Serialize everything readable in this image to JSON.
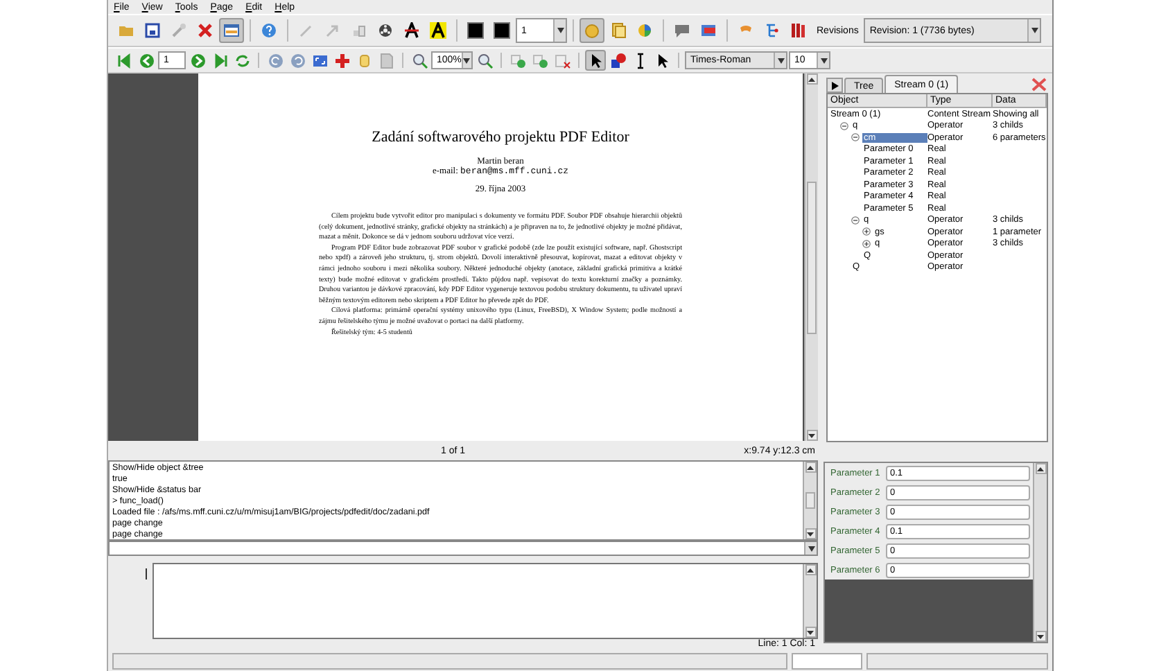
{
  "menu": [
    "File",
    "View",
    "Tools",
    "Page",
    "Edit",
    "Help"
  ],
  "toolbar_top": [
    {
      "kind": "button",
      "pressed": false
    },
    {
      "kind": "button",
      "pressed": false
    },
    {
      "kind": "button",
      "pressed": false
    },
    {
      "kind": "button",
      "pressed": false
    },
    {
      "kind": "button",
      "pressed": true
    },
    {
      "kind": "separator"
    },
    {
      "kind": "button",
      "pressed": false
    },
    {
      "kind": "separator"
    },
    {
      "kind": "button",
      "pressed": false
    },
    {
      "kind": "button",
      "pressed": false
    },
    {
      "kind": "button",
      "pressed": false
    },
    {
      "kind": "button",
      "pressed": false
    },
    {
      "kind": "button",
      "pressed": false
    },
    {
      "kind": "button",
      "pressed": false
    },
    {
      "kind": "separator"
    },
    {
      "kind": "button",
      "pressed": false
    },
    {
      "kind": "button",
      "pressed": false
    },
    {
      "kind": "spin",
      "value": "1"
    },
    {
      "kind": "separator"
    },
    {
      "kind": "button",
      "pressed": true
    },
    {
      "kind": "button",
      "pressed": false
    },
    {
      "kind": "button",
      "pressed": false
    },
    {
      "kind": "separator"
    },
    {
      "kind": "button",
      "pressed": false
    },
    {
      "kind": "button",
      "pressed": false
    },
    {
      "kind": "separator"
    },
    {
      "kind": "button",
      "pressed": false
    },
    {
      "kind": "button",
      "pressed": false
    },
    {
      "kind": "button",
      "pressed": false
    },
    {
      "kind": "label",
      "text": "Revisions"
    },
    {
      "kind": "combo",
      "value": "Revision: 1 (7736 bytes)"
    }
  ],
  "toolbar_bottom": [
    {
      "kind": "button",
      "pressed": false
    },
    {
      "kind": "button",
      "pressed": false
    },
    {
      "kind": "spin",
      "value": "1"
    },
    {
      "kind": "button",
      "pressed": false
    },
    {
      "kind": "button",
      "pressed": false
    },
    {
      "kind": "button",
      "pressed": false
    },
    {
      "kind": "separator"
    },
    {
      "kind": "button",
      "pressed": false
    },
    {
      "kind": "button",
      "pressed": false
    },
    {
      "kind": "button",
      "pressed": false
    },
    {
      "kind": "button",
      "pressed": false
    },
    {
      "kind": "button",
      "pressed": false
    },
    {
      "kind": "button",
      "pressed": false
    },
    {
      "kind": "separator"
    },
    {
      "kind": "button",
      "pressed": false
    },
    {
      "kind": "combo",
      "value": "100%"
    },
    {
      "kind": "button",
      "pressed": false
    },
    {
      "kind": "separator"
    },
    {
      "kind": "button",
      "pressed": false
    },
    {
      "kind": "button",
      "pressed": false
    },
    {
      "kind": "button",
      "pressed": false
    },
    {
      "kind": "separator"
    },
    {
      "kind": "button",
      "pressed": true
    },
    {
      "kind": "button",
      "pressed": false
    },
    {
      "kind": "button",
      "pressed": false
    },
    {
      "kind": "button",
      "pressed": false
    },
    {
      "kind": "separator"
    },
    {
      "kind": "combo",
      "value": "Times-Roman"
    },
    {
      "kind": "combo",
      "value": "10"
    }
  ],
  "document": {
    "title": "Zadání softwarového projektu PDF Editor",
    "author": "Martin beran",
    "email_label": "e-mail:",
    "email": "beran@ms.mff.cuni.cz",
    "date": "29. října 2003",
    "paragraphs": [
      "Cílem projektu bude vytvořit editor pro manipulaci s dokumenty ve formátu PDF. Soubor PDF obsahuje hierarchii objektů (celý dokument, jednotlivé stránky, grafické objekty na stránkách) a je připraven na to, že jednotlivé objekty je možné přidávat, mazat a měnit. Dokonce se dá v jednom souboru udržovat více verzí.",
      "Program PDF Editor bude zobrazovat PDF soubor v grafické podobě (zde lze použít existující software, např. Ghostscript nebo xpdf) a zároveň jeho strukturu, tj. strom objektů. Dovolí interaktivně přesouvat, kopírovat, mazat a editovat objekty v rámci jednoho souboru i mezi několika soubory. Některé jednoduché objekty (anotace, základní grafická primitiva a krátké texty) bude možné editovat v grafickém prostředí. Takto půjdou např. vepisovat do textu korekturní značky a poznámky. Druhou variantou je dávkové zpracování, kdy PDF Editor vygeneruje textovou podobu struktury dokumentu, tu uživatel upraví běžným textovým editorem nebo skriptem a PDF Editor ho převede zpět do PDF.",
      "Cílová platforma: primárně operační systémy unixového typu (Linux, FreeBSD), X Window System; podle možností a zájmu řešitelského týmu je možné uvažovat o portaci na další platformy.",
      "Řešitelský tým: 4-5 studentů"
    ]
  },
  "page_status": {
    "page": "1 of 1",
    "coords": "x:9.74 y:12.3 cm"
  },
  "console": [
    "Show/Hide object &tree",
    "true",
    "Show/Hide &status bar",
    "> func_load()",
    "Loaded file : /afs/ms.mff.cuni.cz/u/m/misuj1am/BIG/projects/pdfedit/doc/zadani.pdf",
    "page change",
    "page change"
  ],
  "editor": {
    "position": "Line: 1 Col: 1"
  },
  "tabs": [
    {
      "label": "Tree",
      "selected": false
    },
    {
      "label": "Stream 0 (1)",
      "selected": true
    }
  ],
  "tree": {
    "columns": [
      "Object",
      "Type",
      "Data"
    ],
    "rows": [
      {
        "object": "Stream 0 (1)",
        "type": "Content Stream",
        "data": "Showing all",
        "children": [
          {
            "object": "q",
            "type": "Operator",
            "data": "3 childs",
            "expanded": true,
            "selected": false,
            "children": [
              {
                "object": "cm",
                "type": "Operator",
                "data": "6 parameters",
                "expanded": true,
                "selected": true,
                "children": [
                  {
                    "object": "Parameter 0",
                    "type": "Real",
                    "selected": false
                  },
                  {
                    "object": "Parameter 1",
                    "type": "Real",
                    "selected": false
                  },
                  {
                    "object": "Parameter 2",
                    "type": "Real",
                    "selected": false
                  },
                  {
                    "object": "Parameter 3",
                    "type": "Real",
                    "selected": false
                  },
                  {
                    "object": "Parameter 4",
                    "type": "Real",
                    "selected": false
                  },
                  {
                    "object": "Parameter 5",
                    "type": "Real",
                    "selected": false
                  }
                ]
              },
              {
                "object": "q",
                "type": "Operator",
                "data": "3 childs",
                "expanded": true,
                "selected": false,
                "children": [
                  {
                    "object": "gs",
                    "type": "Operator",
                    "data": "1 parameter",
                    "expanded": false,
                    "selected": false
                  },
                  {
                    "object": "q",
                    "type": "Operator",
                    "data": "3 childs",
                    "expanded": false,
                    "selected": false
                  },
                  {
                    "object": "Q",
                    "type": "Operator",
                    "selected": false
                  }
                ]
              },
              {
                "object": "Q",
                "type": "Operator",
                "selected": false
              }
            ]
          }
        ]
      }
    ]
  },
  "parameters": [
    {
      "label": "Parameter 1",
      "value": "0.1"
    },
    {
      "label": "Parameter 2",
      "value": "0"
    },
    {
      "label": "Parameter 3",
      "value": "0"
    },
    {
      "label": "Parameter 4",
      "value": "0.1"
    },
    {
      "label": "Parameter 5",
      "value": "0"
    },
    {
      "label": "Parameter 6",
      "value": "0"
    }
  ]
}
